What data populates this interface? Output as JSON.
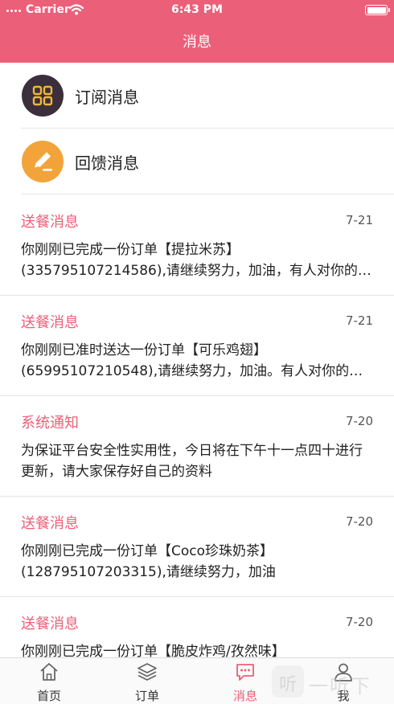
{
  "status_bar": {
    "carrier": "Carrier",
    "time": "6:43 PM"
  },
  "header": {
    "title": "消息"
  },
  "menu": [
    {
      "label": "订阅消息",
      "icon": "grid-icon"
    },
    {
      "label": "回馈消息",
      "icon": "pencil-icon"
    }
  ],
  "messages": [
    {
      "type": "送餐消息",
      "date": "7-21",
      "body": "你刚刚已完成一份订单【提拉米苏】(335795107214586),请继续努力，加油，有人对你的服务进行了评价"
    },
    {
      "type": "送餐消息",
      "date": "7-21",
      "body": "你刚刚已准时送达一份订单【可乐鸡翅】(65995107210548),请继续努力，加油。有人对你的服务进行了评价"
    },
    {
      "type": "系统通知",
      "date": "7-20",
      "body": "为保证平台安全性实用性，今日将在下午十一点四十进行更新，请大家保存好自己的资料"
    },
    {
      "type": "送餐消息",
      "date": "7-20",
      "body": "你刚刚已完成一份订单【Coco珍珠奶茶】(128795107203315),请继续努力，加油"
    },
    {
      "type": "送餐消息",
      "date": "7-20",
      "body": "你刚刚已完成一份订单【脆皮炸鸡/孜然味】"
    }
  ],
  "tabbar": [
    {
      "label": "首页",
      "icon": "home-icon",
      "active": false
    },
    {
      "label": "订单",
      "icon": "layers-icon",
      "active": false
    },
    {
      "label": "消息",
      "icon": "chat-icon",
      "active": true
    },
    {
      "label": "我",
      "icon": "user-icon",
      "active": false
    }
  ],
  "watermark": {
    "logo_glyph": "听",
    "text": "一听下载"
  },
  "colors": {
    "accent": "#ec5f79",
    "subscribe_icon_bg": "#3a2f3a",
    "feedback_icon_bg": "#f2a33a"
  }
}
